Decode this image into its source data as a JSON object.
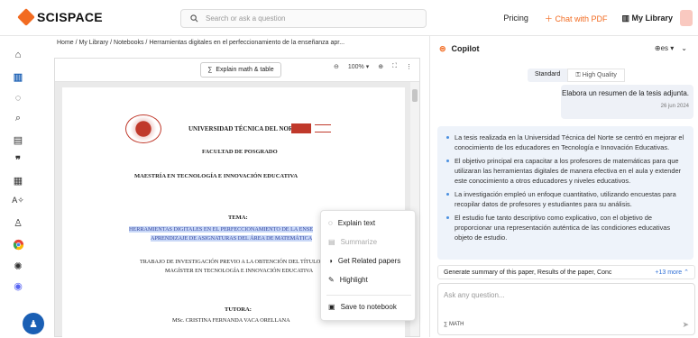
{
  "brand": {
    "name": "SCISPACE",
    "color": "#f26b21"
  },
  "search": {
    "placeholder": "Search or ask a question"
  },
  "nav": {
    "pricing": "Pricing",
    "chat_pdf": "Chat with PDF",
    "my_library": "My Library"
  },
  "breadcrumb": "Home / My Library / Notebooks / Herramientas digitales en el perfeccionamiento de la enseñanza apr...",
  "viewer": {
    "explain_btn": "Explain math & table",
    "zoom": "100%"
  },
  "doc": {
    "university": "UNIVERSIDAD TÉCNICA DEL NORTE",
    "faculty": "FACULTAD DE POSGRADO",
    "program": "MAESTRÍA EN TECNOLOGÍA E INNOVACIÓN EDUCATIVA",
    "tema_label": "TEMA:",
    "tema_line1": "HERRAMIENTAS DIGITALES EN EL PERFECCIONAMIENTO DE LA ENSE",
    "tema_line2": "APRENDIZAJE DE ASIGNATURAS DEL ÁREA DE MATEMÁTICA",
    "work_line1": "TRABAJO DE INVESTIGACIÓN PREVIO A LA OBTENCIÓN DEL TÍTULO",
    "work_line2": "MAGÍSTER EN TECNOLOGÍA E INNOVACIÓN EDUCATIVA",
    "tutora_label": "TUTORA:",
    "tutora_name": "MSc. CRISTINA FERNANDA VACA ORELLANA"
  },
  "context_menu": {
    "explain": "Explain text",
    "summarize": "Summarize",
    "related": "Get Related papers",
    "highlight": "Highlight",
    "save": "Save to notebook"
  },
  "copilot": {
    "title": "Copilot",
    "lang": "es",
    "mode_standard": "Standard",
    "mode_hq": "High Quality",
    "user_message": "Elabora un resumen de la tesis adjunta.",
    "user_date": "26 jun 2024",
    "answer": [
      "La tesis realizada en la Universidad Técnica del Norte se centró en mejorar el conocimiento de los educadores en Tecnología e Innovación Educativas.",
      "El objetivo principal era capacitar a los profesores de matemáticas para que utilizaran las herramientas digitales de manera efectiva en el aula y extender este conocimiento a otros educadores y niveles educativos.",
      "La investigación empleó un enfoque cuantitativo, utilizando encuestas para recopilar datos de profesores y estudiantes para su análisis.",
      "El estudio fue tanto descriptivo como explicativo, con el objetivo de proporcionar una representación auténtica de las condiciones educativas objeto de estudio."
    ],
    "suggestion": "Generate summary of this paper, Results of the paper, Conc",
    "more": "+13 more",
    "ask_placeholder": "Ask any question...",
    "math_label": "MATH"
  }
}
